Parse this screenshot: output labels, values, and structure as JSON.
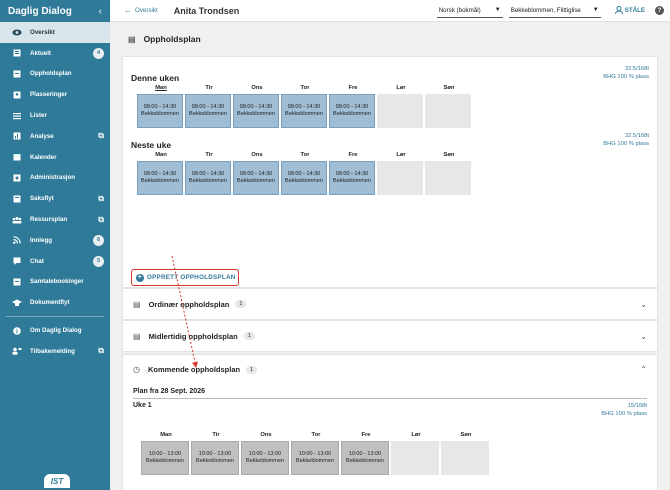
{
  "app": {
    "title": "Daglig Dialog",
    "collapse_icon": "chevron-left-icon",
    "logo_text": "IST"
  },
  "sidebar": {
    "items": [
      {
        "label": "Oversikt",
        "icon": "eye-icon",
        "active": true
      },
      {
        "label": "Aktuelt",
        "icon": "news-icon",
        "badge": "4"
      },
      {
        "label": "Oppholdsplan",
        "icon": "plan-icon"
      },
      {
        "label": "Plasseringer",
        "icon": "badge-icon"
      },
      {
        "label": "Lister",
        "icon": "list-icon"
      },
      {
        "label": "Analyse",
        "icon": "bar-chart-icon",
        "external": true
      },
      {
        "label": "Kalender",
        "icon": "calendar-icon"
      },
      {
        "label": "Administrasjon",
        "icon": "admin-icon"
      },
      {
        "label": "Saksflyt",
        "icon": "case-icon",
        "external": true
      },
      {
        "label": "Ressursplan",
        "icon": "people-icon",
        "external": true
      },
      {
        "label": "Innlegg",
        "icon": "rss-icon",
        "badge": "6"
      },
      {
        "label": "Chat",
        "icon": "chat-icon",
        "badge": "5"
      },
      {
        "label": "Samtalebookinger",
        "icon": "booking-icon"
      },
      {
        "label": "Dokumentflyt",
        "icon": "graduation-cap-icon"
      }
    ],
    "bottom_items": [
      {
        "label": "Om Daglig Dialog",
        "icon": "info-icon"
      },
      {
        "label": "Tilbakemelding",
        "icon": "feedback-icon",
        "external": true
      }
    ]
  },
  "topbar": {
    "back_label": "Oversikt",
    "person_name": "Anita Trondsen",
    "language": "Norsk (bokmål)",
    "unit": "Bekkeblommen, Flittiglise",
    "user": "STÅLE",
    "help": "?"
  },
  "page": {
    "title": "Oppholdsplan"
  },
  "denne_uke": {
    "title": "Denne uken",
    "hours": "32.5/168t",
    "place": "BHG 100 % plass",
    "days": [
      "Man",
      "Tir",
      "Ons",
      "Tor",
      "Fre",
      "Lør",
      "Søn"
    ],
    "cells": [
      {
        "time": "08:00 - 14:30",
        "unit": "Bekkeblommen"
      },
      {
        "time": "08:00 - 14:30",
        "unit": "Bekkeblommen"
      },
      {
        "time": "08:00 - 14:30",
        "unit": "Bekkeblommen"
      },
      {
        "time": "08:00 - 14:30",
        "unit": "Bekkeblommen"
      },
      {
        "time": "08:00 - 14:30",
        "unit": "Bekkeblommen"
      }
    ]
  },
  "neste_uke": {
    "title": "Neste uke",
    "hours": "32.5/168t",
    "place": "BHG 100 % plass",
    "days": [
      "Man",
      "Tir",
      "Ons",
      "Tor",
      "Fre",
      "Lør",
      "Søn"
    ],
    "cells": [
      {
        "time": "08:00 - 14:30",
        "unit": "Bekkeblommen"
      },
      {
        "time": "08:00 - 14:30",
        "unit": "Bekkeblommen"
      },
      {
        "time": "08:00 - 14:30",
        "unit": "Bekkeblommen"
      },
      {
        "time": "08:00 - 14:30",
        "unit": "Bekkeblommen"
      },
      {
        "time": "08:00 - 14:30",
        "unit": "Bekkeblommen"
      }
    ]
  },
  "opprett_label": "OPPRETT OPPHOLDSPLAN",
  "sections": {
    "ordinaer": {
      "label": "Ordinær oppholdsplan",
      "count": "1"
    },
    "midlertidig": {
      "label": "Midlertidig oppholdsplan",
      "count": "1"
    },
    "kommende": {
      "label": "Kommende oppholdsplan",
      "count": "1"
    }
  },
  "kommende_plan": {
    "plan_from": "Plan fra 28 Sept. 2026",
    "week": "Uke 1",
    "hours": "15/168t",
    "place": "BHG 100 % plass",
    "days": [
      "Man",
      "Tir",
      "Ons",
      "Tor",
      "Fre",
      "Lør",
      "Søn"
    ],
    "cells": [
      {
        "time": "10:00 - 13:00",
        "unit": "Bekkeblommen"
      },
      {
        "time": "10:00 - 13:00",
        "unit": "Bekkeblommen"
      },
      {
        "time": "10:00 - 13:00",
        "unit": "Bekkeblommen"
      },
      {
        "time": "10:00 - 13:00",
        "unit": "Bekkeblommen"
      },
      {
        "time": "10:00 - 13:00",
        "unit": "Bekkeblommen"
      }
    ]
  },
  "colors": {
    "sidebar": "#2f7a99",
    "accent": "#2f7a99",
    "highlight": "#d9342b",
    "cell_blue": "#9fbdd4"
  }
}
